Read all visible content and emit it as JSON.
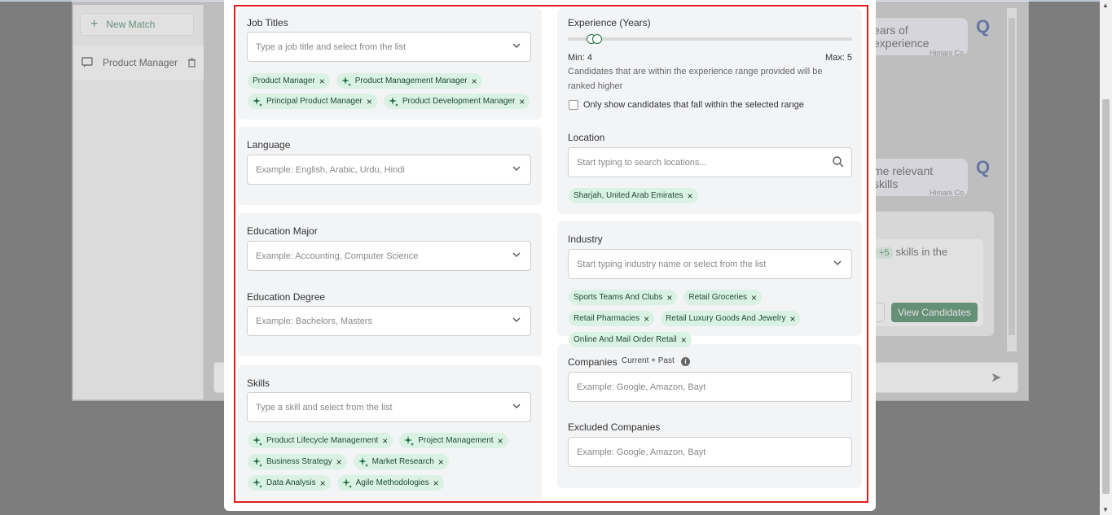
{
  "background": {
    "new_match_label": "New Match",
    "chat_item_label": "Product Manager",
    "msg1": "ears of experience",
    "msg1_author": "Himani Co",
    "msg2": "me relevant skills",
    "msg2_author": "Himani Co",
    "card_plus": "+5",
    "card_text": "skills in the",
    "view_candidates": "View Candidates"
  },
  "job_titles": {
    "label": "Job Titles",
    "placeholder": "Type a job title and select from the list",
    "tags": [
      "Product Manager",
      "Product Management Manager",
      "Principal Product Manager",
      "Product Development Manager"
    ]
  },
  "language": {
    "label": "Language",
    "placeholder": "Example: English, Arabic, Urdu, Hindi"
  },
  "education_major": {
    "label": "Education Major",
    "placeholder": "Example: Accounting, Computer Science"
  },
  "education_degree": {
    "label": "Education Degree",
    "placeholder": "Example: Bachelors, Masters"
  },
  "skills": {
    "label": "Skills",
    "placeholder": "Type a skill and select from the list",
    "tags": [
      "Product Lifecycle Management",
      "Project Management",
      "Business Strategy",
      "Market Research",
      "Data Analysis",
      "Agile Methodologies"
    ]
  },
  "experience": {
    "label": "Experience (Years)",
    "min_label": "Min: 4",
    "max_label": "Max: 5",
    "hint": "Candidates that are within the experience range provided will be ranked higher",
    "checkbox_label": "Only show candidates that fall within the selected range"
  },
  "location": {
    "label": "Location",
    "placeholder": "Start typing to search locations...",
    "tags": [
      "Sharjah, United Arab Emirates"
    ]
  },
  "industry": {
    "label": "Industry",
    "placeholder": "Start typing industry name or select from the list",
    "tags": [
      "Sports Teams And Clubs",
      "Retail Groceries",
      "Retail Pharmacies",
      "Retail Luxury Goods And Jewelry",
      "Online And Mail Order Retail"
    ]
  },
  "companies": {
    "label": "Companies",
    "sublabel": "Current + Past",
    "placeholder": "Example: Google, Amazon, Bayt"
  },
  "excluded_companies": {
    "label": "Excluded Companies",
    "placeholder": "Example: Google, Amazon, Bayt"
  },
  "colors": {
    "accent": "#1d6b3f",
    "tag_bg": "#d9f2e4",
    "highlight": "#e11d1d"
  }
}
